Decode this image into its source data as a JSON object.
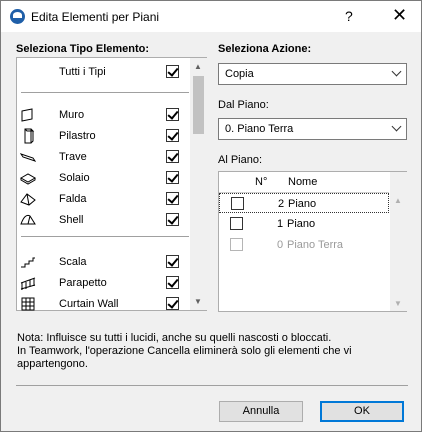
{
  "window": {
    "title": "Edita Elementi per Piani",
    "help_glyph": "?",
    "close_glyph": "✕"
  },
  "left": {
    "section_label": "Seleziona Tipo Elemento:",
    "all_types": {
      "label": "Tutti i Tipi",
      "checked": true
    },
    "items": [
      {
        "label": "Muro",
        "icon": "wall-icon",
        "checked": true
      },
      {
        "label": "Pilastro",
        "icon": "column-icon",
        "checked": true
      },
      {
        "label": "Trave",
        "icon": "beam-icon",
        "checked": true
      },
      {
        "label": "Solaio",
        "icon": "slab-icon",
        "checked": true
      },
      {
        "label": "Falda",
        "icon": "roof-icon",
        "checked": true
      },
      {
        "label": "Shell",
        "icon": "shell-icon",
        "checked": true
      },
      {
        "label": "Scala",
        "icon": "stair-icon",
        "checked": true
      },
      {
        "label": "Parapetto",
        "icon": "railing-icon",
        "checked": true
      },
      {
        "label": "Curtain Wall",
        "icon": "curtain-wall-icon",
        "checked": true
      }
    ]
  },
  "right": {
    "action_label": "Seleziona Azione:",
    "action_value": "Copia",
    "from_floor_label": "Dal Piano:",
    "from_floor_value": "0. Piano Terra",
    "to_floor_label": "Al Piano:",
    "columns": {
      "number": "N°",
      "name": "Nome"
    },
    "floors": [
      {
        "number": "2",
        "name": "Piano",
        "checked": false,
        "enabled": true
      },
      {
        "number": "1",
        "name": "Piano",
        "checked": false,
        "enabled": true
      },
      {
        "number": "0",
        "name": "Piano Terra",
        "checked": false,
        "enabled": false
      }
    ]
  },
  "note": {
    "line1": "Nota: Influisce su tutti i lucidi, anche su quelli nascosti o bloccati.",
    "line2": "In Teamwork, l'operazione Cancella eliminerà solo gli elementi che vi appartengono."
  },
  "buttons": {
    "cancel": "Annulla",
    "ok": "OK"
  },
  "colors": {
    "accent": "#0078d7",
    "dialog_bg": "#f0f0f0"
  }
}
